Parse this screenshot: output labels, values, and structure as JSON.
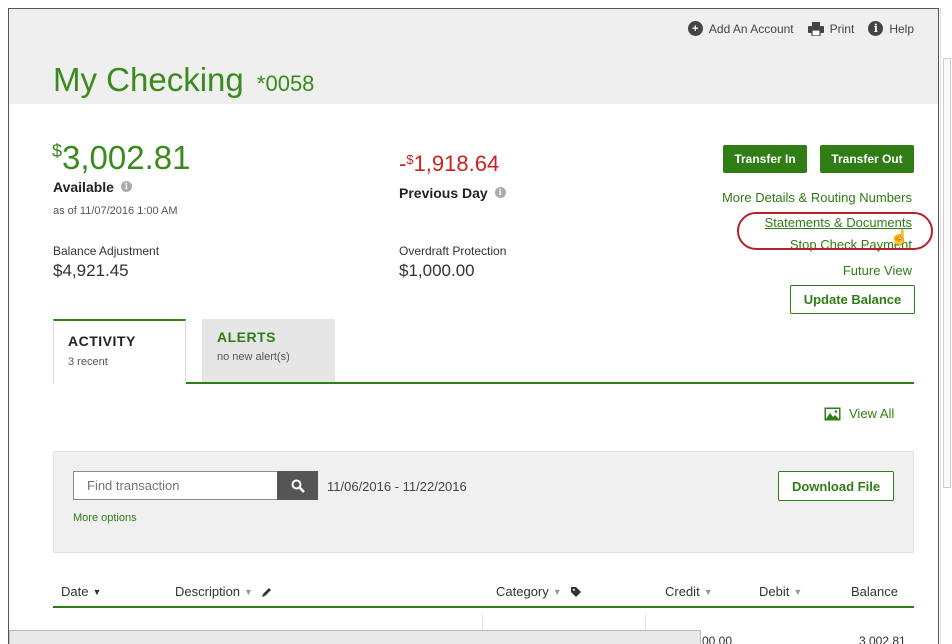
{
  "toplinks": {
    "add_account": "Add An Account",
    "print": "Print",
    "help": "Help"
  },
  "account": {
    "title": "My Checking",
    "number": "*0058"
  },
  "available": {
    "currency": "$",
    "amount": "3,002.81",
    "label": "Available",
    "as_of": "as of 11/07/2016 1:00 AM"
  },
  "previous_day": {
    "sign": "-",
    "currency": "$",
    "amount": "1,918.64",
    "label": "Previous Day"
  },
  "balance_adjustment": {
    "label": "Balance Adjustment",
    "value": "$4,921.45"
  },
  "overdraft": {
    "label": "Overdraft Protection",
    "value": "$1,000.00"
  },
  "buttons": {
    "transfer_in": "Transfer In",
    "transfer_out": "Transfer Out",
    "update_balance": "Update Balance",
    "download_file": "Download File"
  },
  "links": {
    "more_details": "More Details & Routing Numbers",
    "statements": "Statements & Documents",
    "stop_check": "Stop Check Payment",
    "future_view": "Future View",
    "view_all": "View All",
    "more_options": "More options"
  },
  "tabs": [
    {
      "label": "ACTIVITY",
      "sub": "3 recent"
    },
    {
      "label": "ALERTS",
      "sub": "no new alert(s)"
    }
  ],
  "search": {
    "placeholder": "Find transaction",
    "date_range": "11/06/2016 - 11/22/2016"
  },
  "table": {
    "columns": {
      "date": "Date",
      "description": "Description",
      "category": "Category",
      "credit": "Credit",
      "debit": "Debit",
      "balance": "Balance"
    },
    "first_row": {
      "credit": "00.00",
      "balance": "3,002.81"
    }
  },
  "colors": {
    "brand_green": "#2f7d14",
    "negative_red": "#cc2222",
    "highlight_circle": "#b5202a"
  },
  "icons": [
    "plus-circle-icon",
    "printer-icon",
    "info-circle-icon",
    "image-icon",
    "search-icon",
    "pencil-icon",
    "tag-icon",
    "hand-cursor-icon"
  ]
}
